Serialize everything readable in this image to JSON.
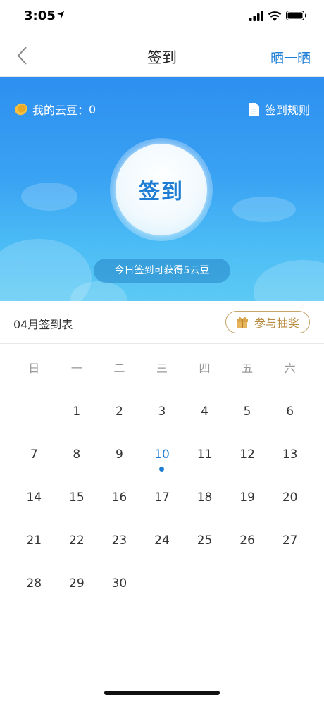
{
  "status_bar": {
    "time": "3:05"
  },
  "nav": {
    "title": "签到",
    "share_label": "晒一晒"
  },
  "banner": {
    "beans_label": "我的云豆：",
    "beans_count": "0",
    "rules_label": "签到规则",
    "sign_label": "签到",
    "reward_text": "今日签到可获得5云豆"
  },
  "month": {
    "label": "04月签到表",
    "lottery_label": "参与抽奖"
  },
  "calendar": {
    "weekdays": [
      "日",
      "一",
      "二",
      "三",
      "四",
      "五",
      "六"
    ],
    "today": "10",
    "weeks": [
      [
        "",
        "1",
        "2",
        "3",
        "4",
        "5",
        "6"
      ],
      [
        "7",
        "8",
        "9",
        "10",
        "11",
        "12",
        "13"
      ],
      [
        "14",
        "15",
        "16",
        "17",
        "18",
        "19",
        "20"
      ],
      [
        "21",
        "22",
        "23",
        "24",
        "25",
        "26",
        "27"
      ],
      [
        "28",
        "29",
        "30",
        "",
        "",
        "",
        ""
      ]
    ]
  },
  "colors": {
    "accent": "#1f7ed3",
    "banner_top": "#2d8ff0",
    "banner_bottom": "#5ccaf4",
    "gold": "#b88a3e"
  }
}
